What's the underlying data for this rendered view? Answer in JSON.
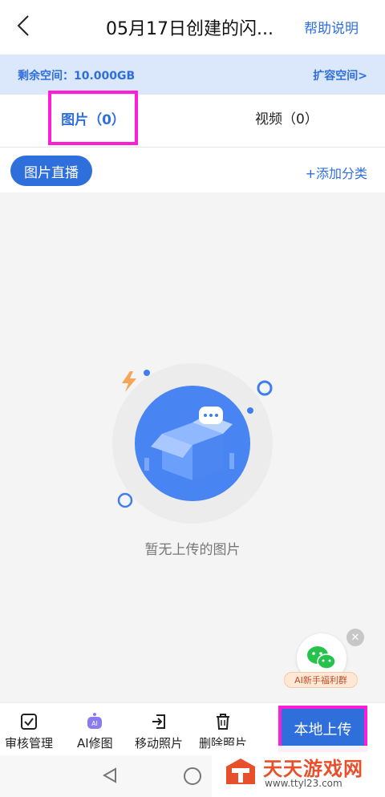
{
  "header": {
    "back_icon": "chevron-left-icon",
    "title": "05月17日创建的闪...",
    "help_label": "帮助说明"
  },
  "storage": {
    "remaining_label": "剩余空间：10.000GB",
    "expand_label": "扩容空间>"
  },
  "tabs": [
    {
      "label": "图片（0）",
      "active": true
    },
    {
      "label": "视频（0）",
      "active": false
    }
  ],
  "category": {
    "live_label": "图片直播",
    "add_label": "+添加分类"
  },
  "empty": {
    "message": "暂无上传的图片",
    "illustration_icon": "empty-box-icon"
  },
  "wechat_float": {
    "icon": "wechat-icon",
    "label": "AI新手福利群",
    "close_icon": "close-icon"
  },
  "toolbar": {
    "items": [
      {
        "label": "审核管理",
        "icon": "checkbox-icon"
      },
      {
        "label": "AI修图",
        "icon": "ai-robot-icon"
      },
      {
        "label": "移动照片",
        "icon": "move-icon"
      },
      {
        "label": "删除照片",
        "icon": "trash-icon"
      }
    ],
    "upload_label": "本地上传"
  },
  "watermark": {
    "title": "天天游戏网",
    "url": "www.ttyl23.com"
  },
  "colors": {
    "accent": "#2f6fdc",
    "highlight": "#ff1dd5",
    "storage_bg": "#dbe7fb"
  }
}
